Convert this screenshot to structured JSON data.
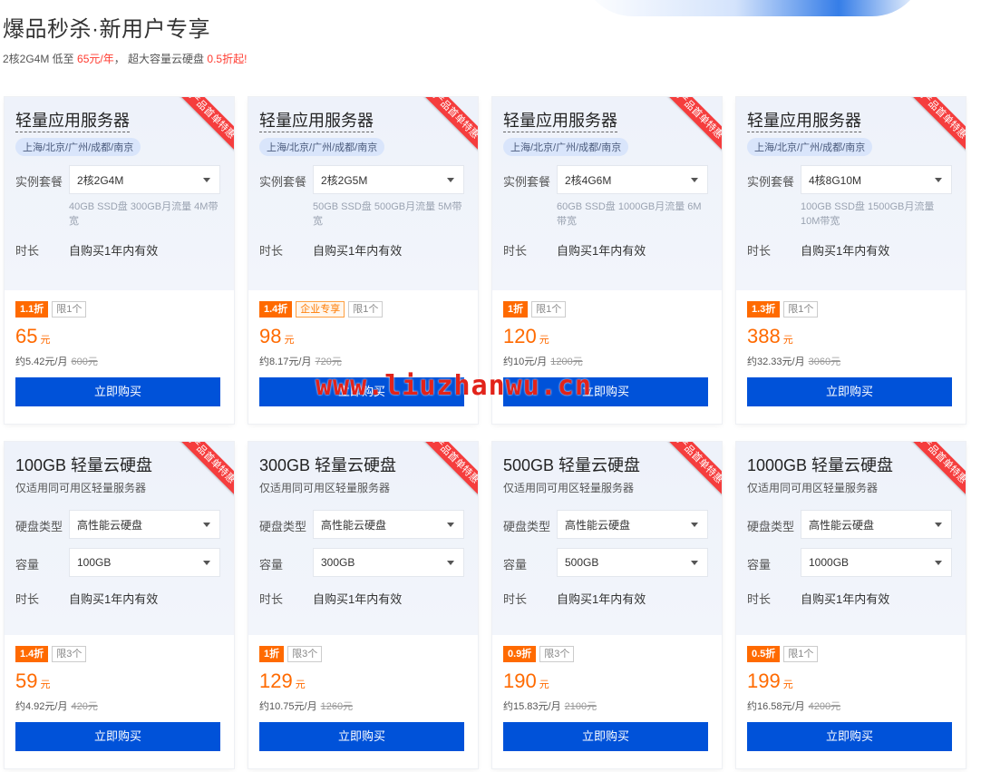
{
  "header": {
    "title": "爆品秒杀·新用户专享",
    "sub_pre": "2核2G4M 低至 ",
    "sub_price": "65元/年",
    "sub_mid": "， 超大容量云硬盘 ",
    "sub_disc": "0.5折起!"
  },
  "ribbon_label": "产品首单特惠",
  "buy_label": "立即购买",
  "duration_label": "时长",
  "duration_value": "自购买1年内有效",
  "server_cards": [
    {
      "title": "轻量应用服务器",
      "region": "上海/北京/广州/成都/南京",
      "pkg_label": "实例套餐",
      "pkg": "2核2G4M",
      "spec": "40GB SSD盘 300GB月流量 4M带宽",
      "disc": "1.1折",
      "ent": "",
      "limit": "限1个",
      "price": "65",
      "unit": "元",
      "monthly": "约5.42元/月",
      "orig": "600元"
    },
    {
      "title": "轻量应用服务器",
      "region": "上海/北京/广州/成都/南京",
      "pkg_label": "实例套餐",
      "pkg": "2核2G5M",
      "spec": "50GB SSD盘 500GB月流量 5M带宽",
      "disc": "1.4折",
      "ent": "企业专享",
      "limit": "限1个",
      "price": "98",
      "unit": "元",
      "monthly": "约8.17元/月",
      "orig": "720元"
    },
    {
      "title": "轻量应用服务器",
      "region": "上海/北京/广州/成都/南京",
      "pkg_label": "实例套餐",
      "pkg": "2核4G6M",
      "spec": "60GB SSD盘 1000GB月流量 6M带宽",
      "disc": "1折",
      "ent": "",
      "limit": "限1个",
      "price": "120",
      "unit": "元",
      "monthly": "约10元/月",
      "orig": "1200元"
    },
    {
      "title": "轻量应用服务器",
      "region": "上海/北京/广州/成都/南京",
      "pkg_label": "实例套餐",
      "pkg": "4核8G10M",
      "spec": "100GB SSD盘 1500GB月流量 10M带宽",
      "disc": "1.3折",
      "ent": "",
      "limit": "限1个",
      "price": "388",
      "unit": "元",
      "monthly": "约32.33元/月",
      "orig": "3060元"
    }
  ],
  "disk_cards": [
    {
      "title": "100GB 轻量云硬盘",
      "desc": "仅适用同可用区轻量服务器",
      "type_label": "硬盘类型",
      "type": "高性能云硬盘",
      "cap_label": "容量",
      "cap": "100GB",
      "disc": "1.4折",
      "limit": "限3个",
      "price": "59",
      "unit": "元",
      "monthly": "约4.92元/月",
      "orig": "420元"
    },
    {
      "title": "300GB 轻量云硬盘",
      "desc": "仅适用同可用区轻量服务器",
      "type_label": "硬盘类型",
      "type": "高性能云硬盘",
      "cap_label": "容量",
      "cap": "300GB",
      "disc": "1折",
      "limit": "限3个",
      "price": "129",
      "unit": "元",
      "monthly": "约10.75元/月",
      "orig": "1260元"
    },
    {
      "title": "500GB 轻量云硬盘",
      "desc": "仅适用同可用区轻量服务器",
      "type_label": "硬盘类型",
      "type": "高性能云硬盘",
      "cap_label": "容量",
      "cap": "500GB",
      "disc": "0.9折",
      "limit": "限3个",
      "price": "190",
      "unit": "元",
      "monthly": "约15.83元/月",
      "orig": "2100元"
    },
    {
      "title": "1000GB 轻量云硬盘",
      "desc": "仅适用同可用区轻量服务器",
      "type_label": "硬盘类型",
      "type": "高性能云硬盘",
      "cap_label": "容量",
      "cap": "1000GB",
      "disc": "0.5折",
      "limit": "限1个",
      "price": "199",
      "unit": "元",
      "monthly": "约16.58元/月",
      "orig": "4200元"
    }
  ],
  "watermark": "www.liuzhanwu.cn"
}
